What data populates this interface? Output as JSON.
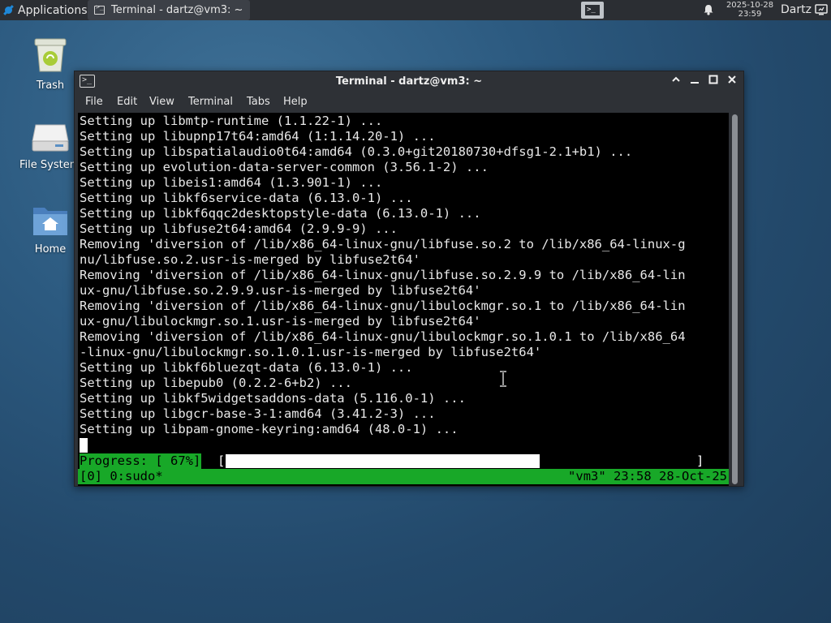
{
  "panel": {
    "applications_label": "Applications",
    "task_title": "Terminal - dartz@vm3: ~",
    "clock_date": "2025-10-28",
    "clock_time": "23:59",
    "user_name": "Dartz"
  },
  "desktop": {
    "icons": [
      {
        "label": "Trash",
        "icon": "trash-icon"
      },
      {
        "label": "File System",
        "icon": "drive-icon"
      },
      {
        "label": "Home",
        "icon": "home-folder-icon"
      }
    ]
  },
  "window": {
    "title": "Terminal - dartz@vm3: ~",
    "controls": [
      "shade",
      "minimize",
      "maximize",
      "close"
    ],
    "menu": [
      "File",
      "Edit",
      "View",
      "Terminal",
      "Tabs",
      "Help"
    ]
  },
  "terminal": {
    "lines": [
      "Setting up libmtp-runtime (1.1.22-1) ...",
      "Setting up libupnp17t64:amd64 (1:1.14.20-1) ...",
      "Setting up libspatialaudio0t64:amd64 (0.3.0+git20180730+dfsg1-2.1+b1) ...",
      "Setting up evolution-data-server-common (3.56.1-2) ...",
      "Setting up libeis1:amd64 (1.3.901-1) ...",
      "Setting up libkf6service-data (6.13.0-1) ...",
      "Setting up libkf6qqc2desktopstyle-data (6.13.0-1) ...",
      "Setting up libfuse2t64:amd64 (2.9.9-9) ...",
      "Removing 'diversion of /lib/x86_64-linux-gnu/libfuse.so.2 to /lib/x86_64-linux-g",
      "nu/libfuse.so.2.usr-is-merged by libfuse2t64'",
      "Removing 'diversion of /lib/x86_64-linux-gnu/libfuse.so.2.9.9 to /lib/x86_64-lin",
      "ux-gnu/libfuse.so.2.9.9.usr-is-merged by libfuse2t64'",
      "Removing 'diversion of /lib/x86_64-linux-gnu/libulockmgr.so.1 to /lib/x86_64-lin",
      "ux-gnu/libulockmgr.so.1.usr-is-merged by libfuse2t64'",
      "Removing 'diversion of /lib/x86_64-linux-gnu/libulockmgr.so.1.0.1 to /lib/x86_64",
      "-linux-gnu/libulockmgr.so.1.0.1.usr-is-merged by libfuse2t64'",
      "Setting up libkf6bluezqt-data (6.13.0-1) ...",
      "Setting up libepub0 (0.2.2-6+b2) ...",
      "Setting up libkf5widgetsaddons-data (5.116.0-1) ...",
      "Setting up libgcr-base-3-1:amd64 (3.41.2-3) ...",
      "Setting up libpam-gnome-keyring:amd64 (48.0-1) ..."
    ],
    "progress_label": "Progress: [ 67%]",
    "progress_open": "[",
    "progress_close": "]",
    "progress_fraction": 0.67,
    "tmux_left": "[0] 0:sudo*",
    "tmux_right": "\"vm3\" 23:58 28-Oct-25"
  },
  "colors": {
    "terminal_bg": "#000000",
    "tmux_green": "#18a828",
    "panel_bg": "#2b2e33",
    "window_bg": "#2e3136"
  }
}
